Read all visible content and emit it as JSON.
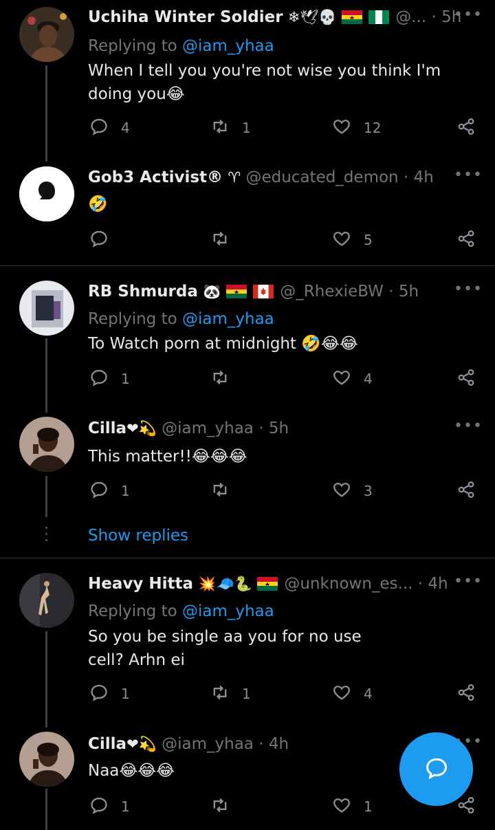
{
  "tweets": [
    {
      "name": "Uchiha Winter Soldier",
      "name_emoji": "❄🕊💀",
      "handle": "@...",
      "time": "5h",
      "reply_prefix": "Replying to",
      "reply_mention": "@iam_yhaa",
      "text": "When I tell you you're not wise you think I'm doing you😂",
      "replies": "4",
      "retweets": "1",
      "likes": "12"
    },
    {
      "name": "Gob3 Activist®",
      "name_emoji": "♈",
      "handle": "@educated_demon",
      "time": "4h",
      "text": "🤣",
      "replies": "",
      "retweets": "",
      "likes": "5"
    },
    {
      "name": "RB Shmurda",
      "name_emoji": "🐼",
      "handle": "@_RhexieBW",
      "time": "5h",
      "reply_prefix": "Replying to",
      "reply_mention": "@iam_yhaa",
      "text": "To Watch porn at midnight 🤣😂😂",
      "replies": "1",
      "retweets": "",
      "likes": "4"
    },
    {
      "name": "Cilla",
      "name_emoji": "❤💫",
      "handle": "@iam_yhaa",
      "time": "5h",
      "text": "This matter!!😂😂😂",
      "replies": "1",
      "retweets": "",
      "likes": "3",
      "show_replies": "Show replies"
    },
    {
      "name": "Heavy Hitta",
      "name_emoji": "💥🧢🐍",
      "handle": "@unknown_es...",
      "time": "4h",
      "reply_prefix": "Replying to",
      "reply_mention": "@iam_yhaa",
      "text": "So you be single aa you for no use cell? Arhn ei",
      "replies": "1",
      "retweets": "1",
      "likes": "4"
    },
    {
      "name": "Cilla",
      "name_emoji": "❤💫",
      "handle": "@iam_yhaa",
      "time": "4h",
      "text": "Naa😂😂😂",
      "replies": "1",
      "retweets": "",
      "likes": "1"
    }
  ],
  "colors": {
    "accent": "#1d9bf0",
    "background": "#000000",
    "muted": "#71767b"
  },
  "icons": {
    "reply": "speech-bubble-icon",
    "retweet": "retweet-icon",
    "like": "heart-icon",
    "share": "share-icon",
    "compose": "compose-reply-icon"
  }
}
